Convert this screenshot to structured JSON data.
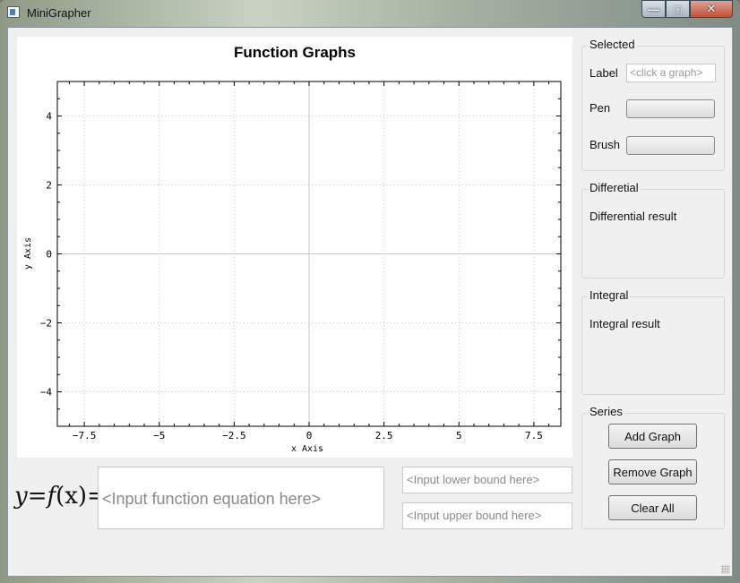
{
  "window": {
    "title": "MiniGrapher",
    "minimize_icon": "minimize-icon",
    "maximize_icon": "maximize-icon",
    "close_icon": "close-icon"
  },
  "chart_data": {
    "type": "line",
    "title": "Function Graphs",
    "xlabel": "x Axis",
    "ylabel": "y Axis",
    "xlim": [
      -8.4,
      8.4
    ],
    "ylim": [
      -5,
      5
    ],
    "xticks": [
      -7.5,
      -5,
      -2.5,
      0,
      2.5,
      5,
      7.5
    ],
    "xtick_labels": [
      "−7.5",
      "−5",
      "−2.5",
      "0",
      "2.5",
      "5",
      "7.5"
    ],
    "yticks": [
      -4,
      -2,
      0,
      2,
      4
    ],
    "ytick_labels": [
      "−4",
      "−2",
      "0",
      "2",
      "4"
    ],
    "grid": true,
    "series": []
  },
  "equation": {
    "y": "y",
    "eq1": "=",
    "f": "f",
    "x": "(x)",
    "eq2": "="
  },
  "inputs": {
    "function_placeholder": "<Input function equation here>",
    "lower_placeholder": "<Input lower bound here>",
    "upper_placeholder": "<Input upper bound here>"
  },
  "selected": {
    "title": "Selected",
    "label_caption": "Label",
    "label_placeholder": "<click a graph>",
    "pen_caption": "Pen",
    "brush_caption": "Brush"
  },
  "differential": {
    "title": "Differetial",
    "result": "Differential result"
  },
  "integral": {
    "title": "Integral",
    "result": "Integral result"
  },
  "series_group": {
    "title": "Series",
    "add": "Add Graph",
    "remove": "Remove Graph",
    "clear": "Clear All"
  }
}
